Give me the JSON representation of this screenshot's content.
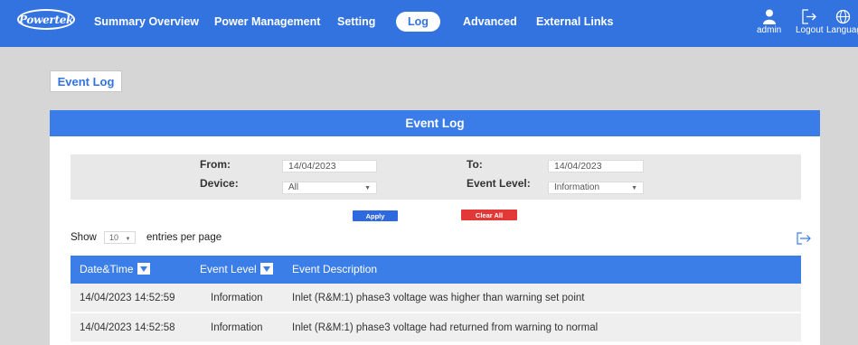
{
  "header": {
    "logo_text": "Powertek",
    "nav": [
      {
        "label": "Summary Overview"
      },
      {
        "label": "Power Management"
      },
      {
        "label": "Setting"
      },
      {
        "label": "Log",
        "active": true
      },
      {
        "label": "Advanced"
      },
      {
        "label": "External Links"
      }
    ],
    "user": {
      "label": "admin",
      "icon": "user-icon"
    },
    "logout": {
      "label": "Logout",
      "icon": "logout-icon"
    },
    "language": {
      "label": "Language",
      "icon": "globe-icon"
    }
  },
  "tab": {
    "label": "Event Log"
  },
  "panel": {
    "title": "Event Log",
    "filters": {
      "from_label": "From:",
      "from_value": "14/04/2023",
      "to_label": "To:",
      "to_value": "14/04/2023",
      "device_label": "Device:",
      "device_value": "All",
      "level_label": "Event Level:",
      "level_value": "Information"
    },
    "apply_label": "Apply",
    "clear_label": "Clear All",
    "show_label": "Show",
    "entries_value": "10",
    "entries_suffix": "entries per page",
    "export_icon": "export-icon",
    "columns": [
      "Date&Time",
      "Event Level",
      "Event Description"
    ],
    "rows": [
      {
        "datetime": "14/04/2023 14:52:59",
        "level": "Information",
        "description": "Inlet (R&M:1) phase3 voltage was higher than warning set point"
      },
      {
        "datetime": "14/04/2023 14:52:58",
        "level": "Information",
        "description": "Inlet (R&M:1) phase3 voltage had returned from warning to normal"
      }
    ]
  },
  "colors": {
    "brand_blue": "#3373e0",
    "clear_red": "#e23838",
    "background": "#d6d6d6"
  }
}
